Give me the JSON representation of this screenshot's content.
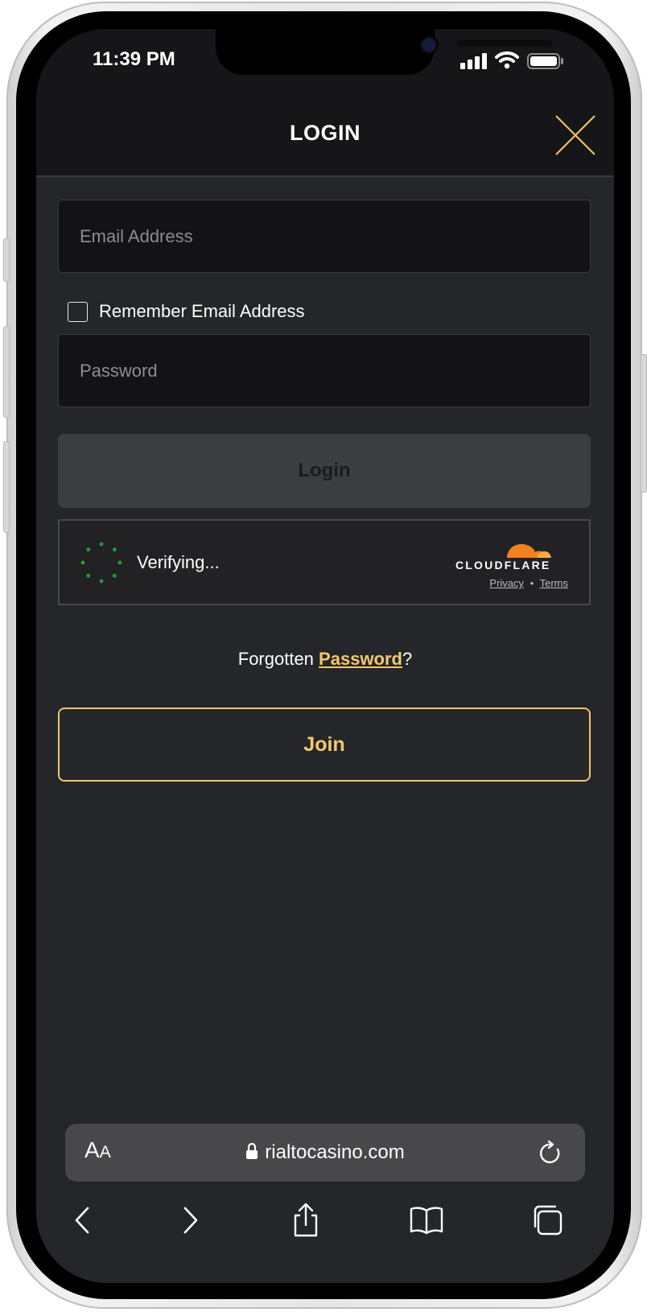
{
  "status_bar": {
    "time": "11:39 PM"
  },
  "header": {
    "title": "LOGIN"
  },
  "form": {
    "email_placeholder": "Email Address",
    "remember_label": "Remember Email Address",
    "password_placeholder": "Password",
    "login_label": "Login"
  },
  "captcha": {
    "status": "Verifying...",
    "brand": "CLOUDFLARE",
    "privacy_link": "Privacy",
    "separator": "•",
    "terms_link": "Terms"
  },
  "forgot": {
    "prefix": "Forgotten",
    "link": "Password",
    "suffix": "?"
  },
  "join_label": "Join",
  "browser": {
    "aa_label_big": "A",
    "aa_label_small": "A",
    "url": "rialtocasino.com"
  },
  "colors": {
    "accent_gold": "#f5c86d",
    "background": "#252629",
    "header": "#161618",
    "spinner_green": "#1e9e3a",
    "cloudflare_orange": "#f48120"
  }
}
